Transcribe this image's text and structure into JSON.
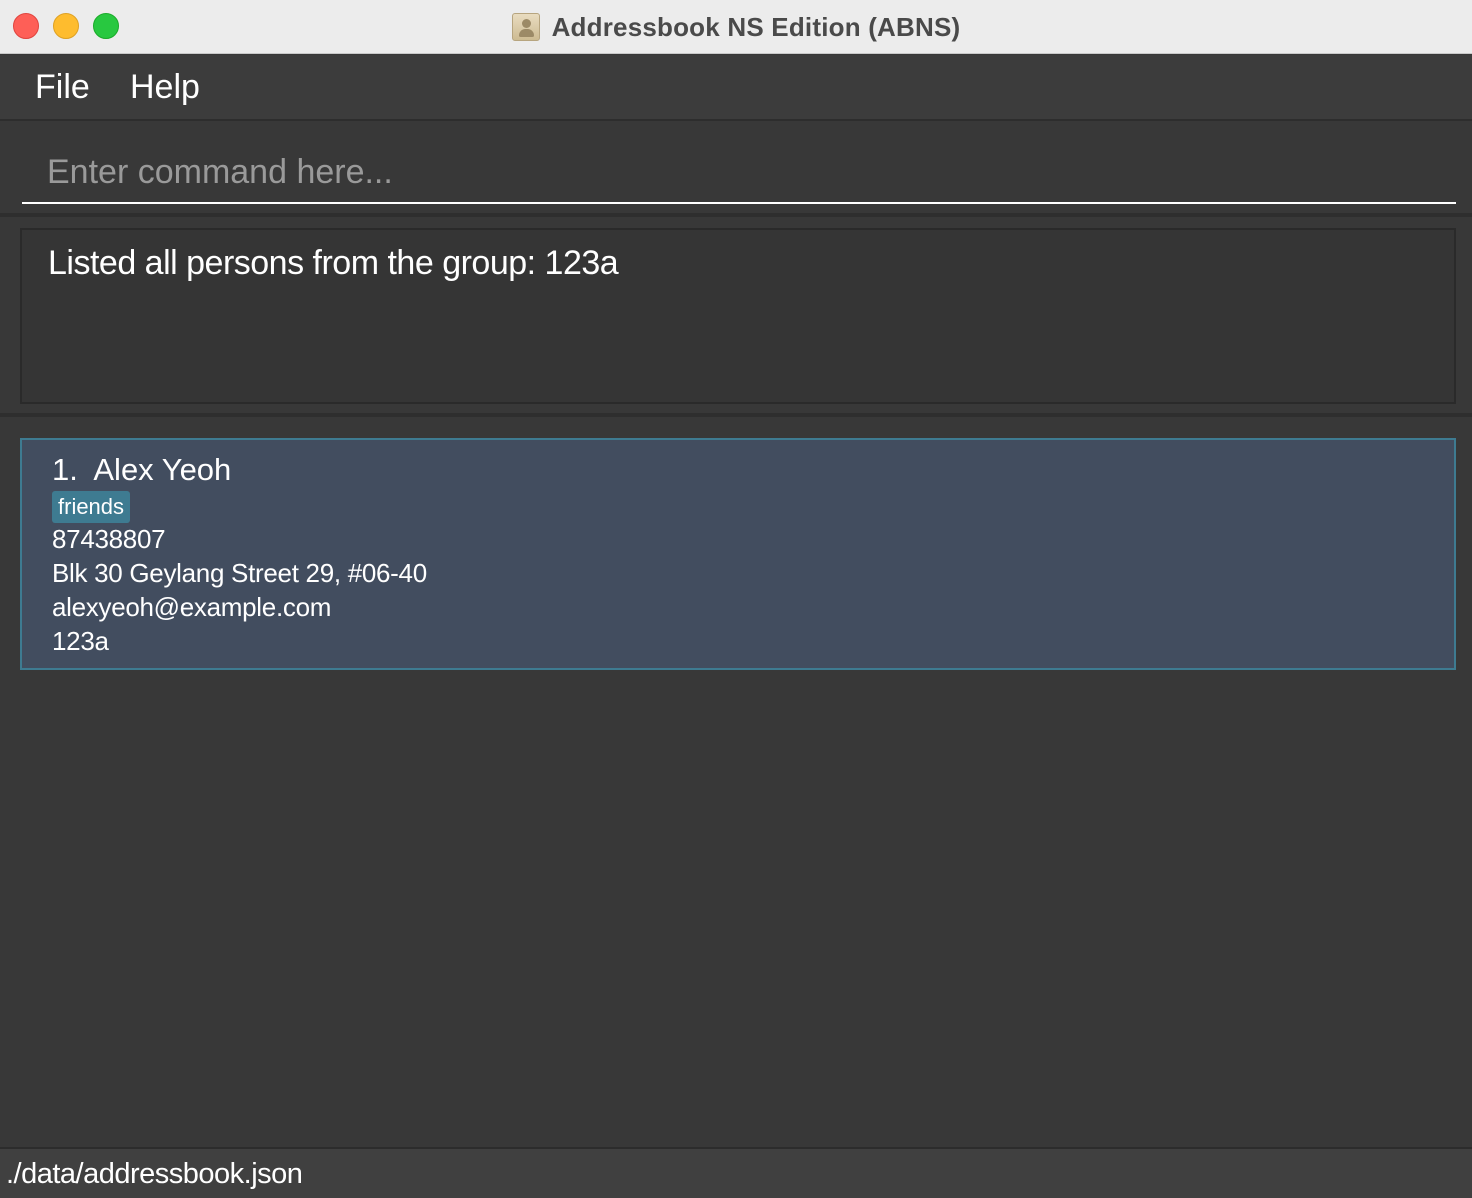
{
  "window": {
    "title": "Addressbook NS Edition (ABNS)",
    "icon": "addressbook-app-icon"
  },
  "menu": {
    "items": [
      {
        "label": "File"
      },
      {
        "label": "Help"
      }
    ]
  },
  "command": {
    "value": "",
    "placeholder": "Enter command here..."
  },
  "result": {
    "message": "Listed all persons from the group: 123a"
  },
  "persons": [
    {
      "index": "1.",
      "name": "Alex Yeoh",
      "tags": [
        "friends"
      ],
      "phone": "87438807",
      "address": "Blk 30 Geylang Street 29, #06-40",
      "email": "alexyeoh@example.com",
      "group": "123a"
    }
  ],
  "status": {
    "file_path": "./data/addressbook.json"
  },
  "colors": {
    "background": "#383838",
    "card": "#424d5f",
    "card_border": "#3e7b91",
    "tag": "#3e7b91",
    "close": "#fe5f57",
    "minimize": "#febc2e",
    "maximize": "#28c840"
  }
}
